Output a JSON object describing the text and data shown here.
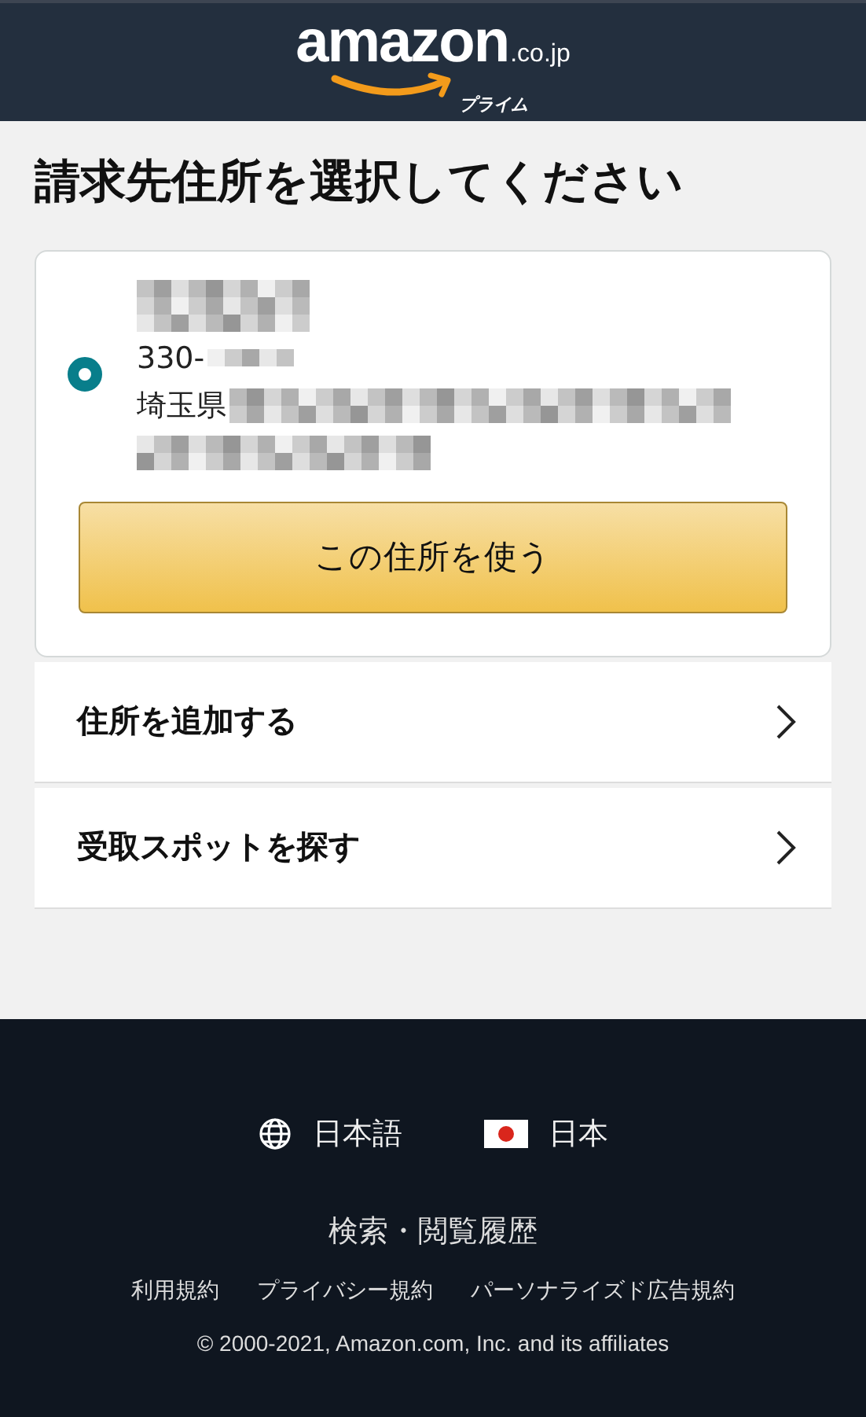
{
  "header": {
    "logo": {
      "wordmark": "amazon",
      "domain": ".co.jp",
      "sub": "プライム"
    }
  },
  "title": "請求先住所を選択してください",
  "address_options": [
    {
      "selected": true,
      "postal_code": "330-",
      "prefecture": "埼玉県",
      "button": "この住所を使う"
    }
  ],
  "links": [
    {
      "label": "住所を追加する"
    },
    {
      "label": "受取スポットを探す"
    }
  ],
  "footer": {
    "language": "日本語",
    "country": "日本",
    "history": "検索・閲覧履歴",
    "policies": [
      "利用規約",
      "プライバシー規約",
      "パーソナライズド広告規約"
    ],
    "copyright": "© 2000-2021, Amazon.com, Inc. and its affiliates"
  }
}
